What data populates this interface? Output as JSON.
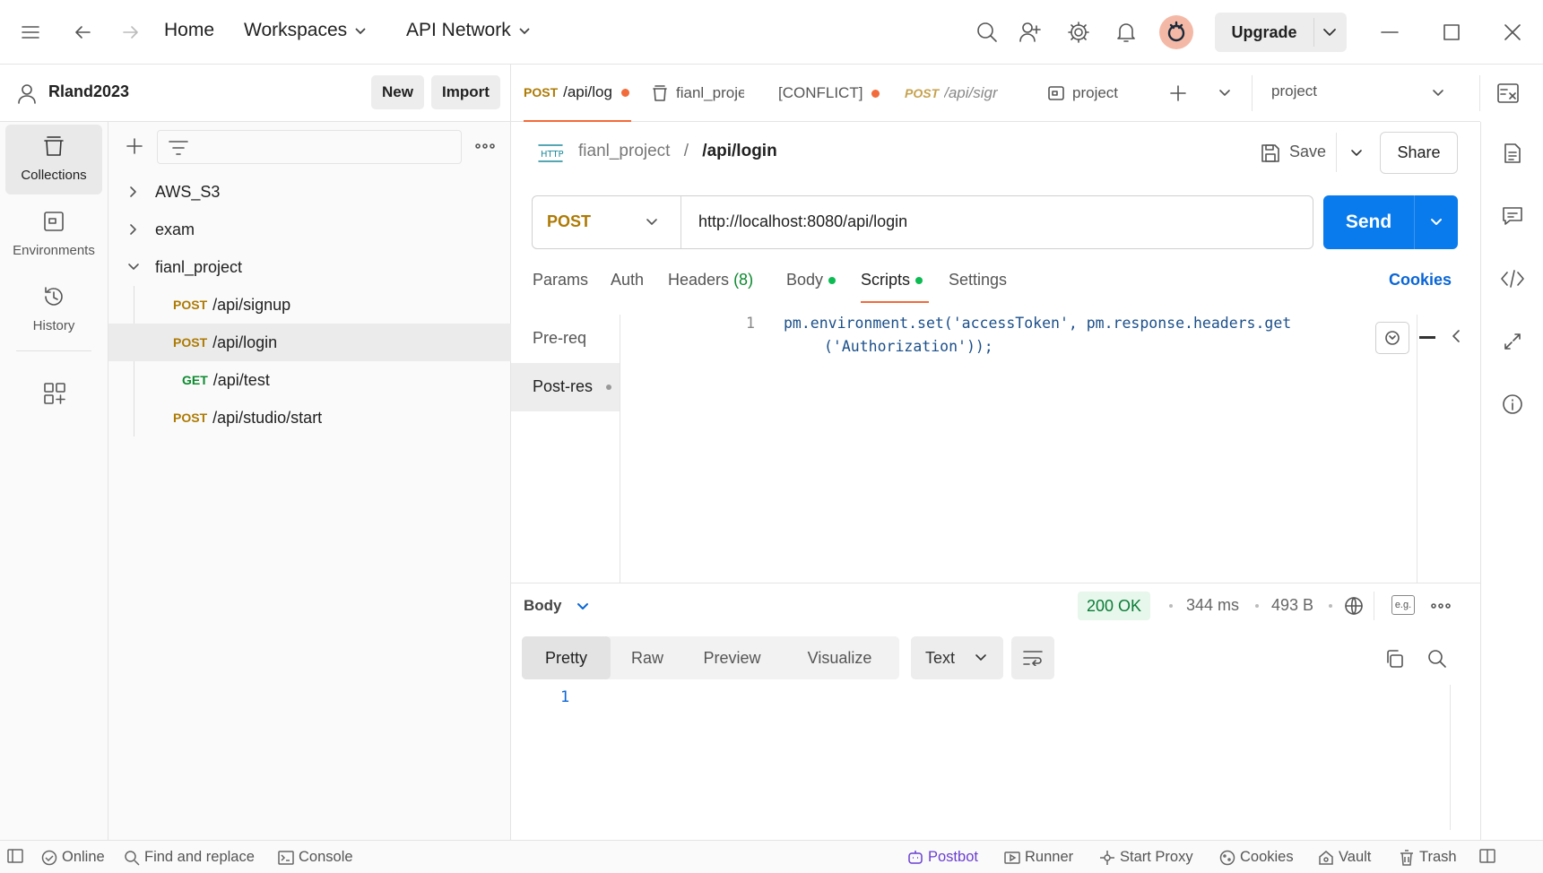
{
  "titlebar": {
    "home": "Home",
    "workspaces": "Workspaces",
    "api_network": "API Network",
    "upgrade": "Upgrade"
  },
  "sidebar_header": {
    "username": "Rland2023",
    "new_label": "New",
    "import_label": "Import"
  },
  "rail": {
    "collections": "Collections",
    "environments": "Environments",
    "history": "History"
  },
  "tree": {
    "items": [
      {
        "label": "AWS_S3"
      },
      {
        "label": "exam"
      },
      {
        "label": "fianl_project"
      }
    ],
    "requests": [
      {
        "method": "POST",
        "path": "/api/signup"
      },
      {
        "method": "POST",
        "path": "/api/login"
      },
      {
        "method": "GET",
        "path": "/api/test"
      },
      {
        "method": "POST",
        "path": "/api/studio/start"
      }
    ]
  },
  "tabs": [
    {
      "method": "POST",
      "label": "/api/log"
    },
    {
      "label": "fianl_proje"
    },
    {
      "label": "[CONFLICT]"
    },
    {
      "method": "POST",
      "label": "/api/sigr"
    },
    {
      "label": "project"
    }
  ],
  "environment_select": "project",
  "request": {
    "breadcrumb_collection": "fianl_project",
    "breadcrumb_sep": "/",
    "breadcrumb_request": "/api/login",
    "save": "Save",
    "share": "Share",
    "method": "POST",
    "url": "http://localhost:8080/api/login",
    "send": "Send",
    "cookies": "Cookies"
  },
  "request_tabs": {
    "params": "Params",
    "auth": "Auth",
    "headers": "Headers",
    "headers_count": "(8)",
    "body": "Body",
    "scripts": "Scripts",
    "settings": "Settings"
  },
  "scripts": {
    "pre": "Pre-req",
    "post": "Post-res",
    "line_no": "1",
    "line1": "pm.environment.set('accessToken', pm.response.headers.get",
    "line2": "('Authorization'));"
  },
  "response": {
    "body_label": "Body",
    "status": "200 OK",
    "time": "344 ms",
    "size": "493 B",
    "eg": "e.g.",
    "views": [
      "Pretty",
      "Raw",
      "Preview",
      "Visualize"
    ],
    "format": "Text",
    "line_no": "1"
  },
  "statusbar": {
    "online": "Online",
    "find_replace": "Find and replace",
    "console": "Console",
    "postbot": "Postbot",
    "runner": "Runner",
    "start_proxy": "Start Proxy",
    "cookies": "Cookies",
    "vault": "Vault",
    "trash": "Trash"
  },
  "colors": {
    "accent": "#097bed",
    "post": "#ad7a03",
    "get": "#0b8a2e",
    "status_ok_bg": "#e7f7ec",
    "status_ok": "#0a7c36",
    "unsaved_dot": "#f26b3a",
    "postbot": "#6b3fd1"
  }
}
